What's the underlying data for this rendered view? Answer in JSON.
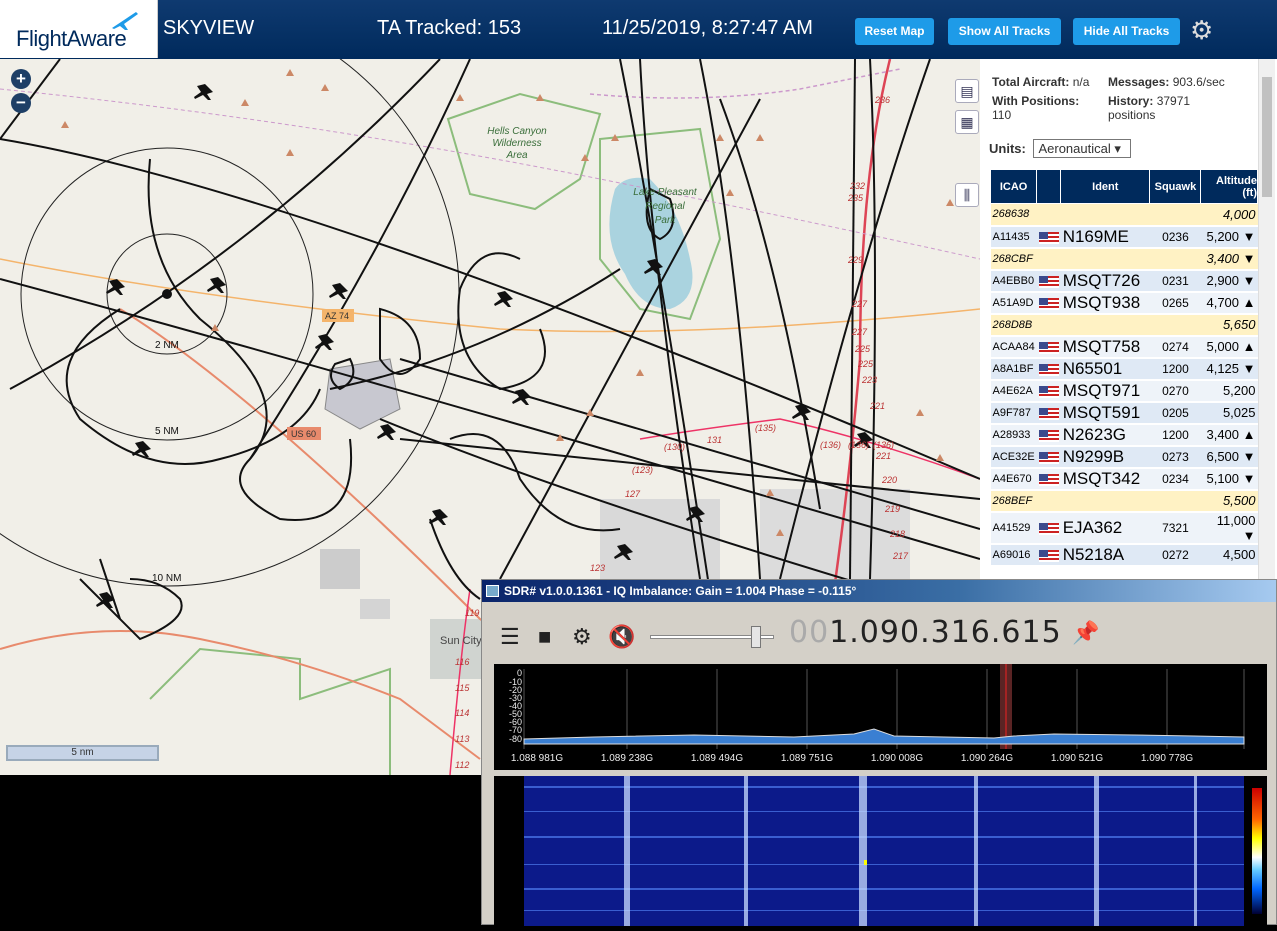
{
  "header": {
    "logo_text": "FlightAware",
    "app_title": "SKYVIEW",
    "ta_tracked": "TA Tracked: 153",
    "clock": "11/25/2019, 8:27:47 AM",
    "buttons": {
      "reset": "Reset Map",
      "show": "Show All Tracks",
      "hide": "Hide All Tracks"
    },
    "settings_icon": "gear-icon"
  },
  "map": {
    "zoom_in": "+",
    "zoom_out": "−",
    "scale": "5 nm",
    "labels": {
      "hells_canyon": "Hells Canyon",
      "wilderness": "Wilderness",
      "area": "Area",
      "lake_pleasant": "Lake Pleasant",
      "regional": "Regional",
      "park": "Park",
      "ring_2": "2 NM",
      "ring_5": "5 NM",
      "ring_10": "10 NM",
      "az74": "AZ 74",
      "us60": "US 60",
      "sun_city": "Sun City"
    },
    "road_numbers": [
      "236",
      "232",
      "235",
      "229",
      "227",
      "227",
      "225",
      "225",
      "223",
      "221",
      "(130)",
      "131",
      "(135)",
      "(136)",
      "(136)",
      "(136)",
      "221",
      "220",
      "219",
      "218",
      "217",
      "123",
      "(123)",
      "127",
      "119",
      "116",
      "115",
      "114",
      "113",
      "112"
    ]
  },
  "panel": {
    "total_aircraft_label": "Total Aircraft:",
    "total_aircraft_value": "n/a",
    "with_positions_label": "With Positions:",
    "with_positions_value": "110",
    "messages_label": "Messages:",
    "messages_value": "903.6/sec",
    "history_label": "History:",
    "history_value": "37971",
    "history_unit": "positions",
    "units_label": "Units:",
    "units_value": "Aeronautical ▾",
    "columns": {
      "icao": "ICAO",
      "ident": "Ident",
      "squawk": "Squawk",
      "altitude": "Altitude",
      "altitude_unit": "(ft)"
    },
    "rows": [
      {
        "icao": "268638",
        "flag": false,
        "ident": "",
        "squawk": "",
        "alt": "4,000"
      },
      {
        "icao": "A11435",
        "flag": true,
        "ident": "N169ME",
        "squawk": "0236",
        "alt": "5,200 ▼"
      },
      {
        "icao": "268CBF",
        "flag": false,
        "ident": "",
        "squawk": "",
        "alt": "3,400 ▼"
      },
      {
        "icao": "A4EBB0",
        "flag": true,
        "ident": "MSQT726",
        "squawk": "0231",
        "alt": "2,900 ▼"
      },
      {
        "icao": "A51A9D",
        "flag": true,
        "ident": "MSQT938",
        "squawk": "0265",
        "alt": "4,700 ▲"
      },
      {
        "icao": "268D8B",
        "flag": false,
        "ident": "",
        "squawk": "",
        "alt": "5,650"
      },
      {
        "icao": "ACAA84",
        "flag": true,
        "ident": "MSQT758",
        "squawk": "0274",
        "alt": "5,000 ▲"
      },
      {
        "icao": "A8A1BF",
        "flag": true,
        "ident": "N65501",
        "squawk": "1200",
        "alt": "4,125 ▼"
      },
      {
        "icao": "A4E62A",
        "flag": true,
        "ident": "MSQT971",
        "squawk": "0270",
        "alt": "5,200"
      },
      {
        "icao": "A9F787",
        "flag": true,
        "ident": "MSQT591",
        "squawk": "0205",
        "alt": "5,025"
      },
      {
        "icao": "A28933",
        "flag": true,
        "ident": "N2623G",
        "squawk": "1200",
        "alt": "3,400 ▲"
      },
      {
        "icao": "ACE32E",
        "flag": true,
        "ident": "N9299B",
        "squawk": "0273",
        "alt": "6,500 ▼"
      },
      {
        "icao": "A4E670",
        "flag": true,
        "ident": "MSQT342",
        "squawk": "0234",
        "alt": "5,100 ▼"
      },
      {
        "icao": "268BEF",
        "flag": false,
        "ident": "",
        "squawk": "",
        "alt": "5,500"
      },
      {
        "icao": "A41529",
        "flag": true,
        "ident": "EJA362",
        "squawk": "7321",
        "alt": "11,000 ▼"
      },
      {
        "icao": "A69016",
        "flag": true,
        "ident": "N5218A",
        "squawk": "0272",
        "alt": "4,500"
      }
    ]
  },
  "sdr": {
    "title": "SDR# v1.0.0.1361 - IQ Imbalance: Gain = 1.004 Phase = -0.115°",
    "freq_dim": "00",
    "freq_main": "1.090.316.615",
    "db_ticks": [
      "0",
      "-10",
      "-20",
      "-30",
      "-40",
      "-50",
      "-60",
      "-70",
      "-80"
    ],
    "freq_ticks": [
      "1.088 981G",
      "1.089 238G",
      "1.089 494G",
      "1.089 751G",
      "1.090 008G",
      "1.090 264G",
      "1.090 521G",
      "1.090 778G"
    ]
  }
}
